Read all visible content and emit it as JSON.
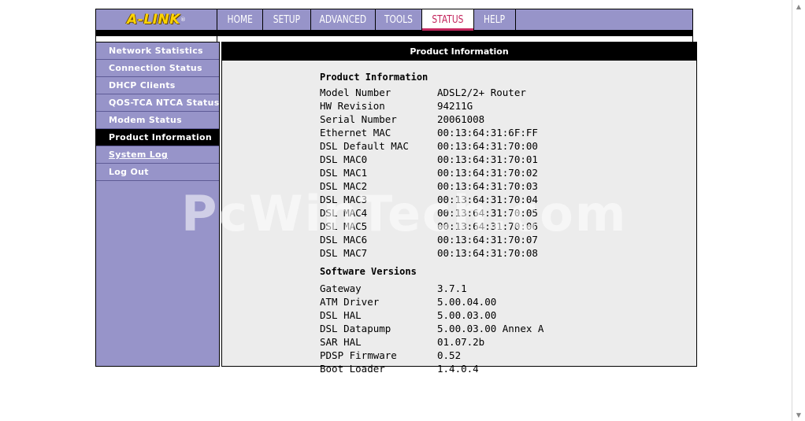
{
  "header": {
    "logo_text": "A-LINK",
    "logo_mark": "®",
    "tabs": [
      {
        "label": "HOME",
        "active": false
      },
      {
        "label": "SETUP",
        "active": false
      },
      {
        "label": "ADVANCED",
        "active": false
      },
      {
        "label": "TOOLS",
        "active": false
      },
      {
        "label": "STATUS",
        "active": true
      },
      {
        "label": "HELP",
        "active": false
      }
    ]
  },
  "sidebar": {
    "items": [
      {
        "label": "Network Statistics"
      },
      {
        "label": "Connection Status"
      },
      {
        "label": "DHCP Clients"
      },
      {
        "label": "QOS-TCA NTCA Status"
      },
      {
        "label": "Modem Status"
      },
      {
        "label": "Product Information",
        "active": true
      },
      {
        "label": "System Log"
      },
      {
        "label": "Log Out"
      }
    ]
  },
  "content": {
    "header": "Product Information",
    "product_section_title": "Product Information",
    "product_rows": [
      {
        "key": "Model Number",
        "value": "ADSL2/2+ Router"
      },
      {
        "key": "HW Revision",
        "value": "94211G"
      },
      {
        "key": "Serial Number",
        "value": "20061008"
      },
      {
        "key": "Ethernet MAC",
        "value": "00:13:64:31:6F:FF"
      },
      {
        "key": "DSL Default MAC",
        "value": "00:13:64:31:70:00"
      },
      {
        "key": "DSL MAC0",
        "value": "00:13:64:31:70:01"
      },
      {
        "key": "DSL MAC1",
        "value": "00:13:64:31:70:02"
      },
      {
        "key": "DSL MAC2",
        "value": "00:13:64:31:70:03"
      },
      {
        "key": "DSL MAC3",
        "value": "00:13:64:31:70:04"
      },
      {
        "key": "DSL MAC4",
        "value": "00:13:64:31:70:05"
      },
      {
        "key": "DSL MAC5",
        "value": "00:13:64:31:70:06"
      },
      {
        "key": "DSL MAC6",
        "value": "00:13:64:31:70:07"
      },
      {
        "key": "DSL MAC7",
        "value": "00:13:64:31:70:08"
      }
    ],
    "software_section_title": "Software Versions",
    "software_rows": [
      {
        "key": "Gateway",
        "value": "3.7.1"
      },
      {
        "key": "ATM Driver",
        "value": "5.00.04.00"
      },
      {
        "key": "DSL HAL",
        "value": "5.00.03.00"
      },
      {
        "key": "DSL Datapump",
        "value": "5.00.03.00 Annex A"
      },
      {
        "key": "SAR HAL",
        "value": "01.07.2b"
      },
      {
        "key": "PDSP Firmware",
        "value": "0.52"
      },
      {
        "key": "Boot Loader",
        "value": "1.4.0.4"
      }
    ]
  },
  "watermark": "PcWinTech.com",
  "colors": {
    "nav_bg": "#9794c9",
    "active_tab_accent": "#c4275e",
    "logo_yellow": "#ffd400",
    "content_bg": "#ececec"
  }
}
